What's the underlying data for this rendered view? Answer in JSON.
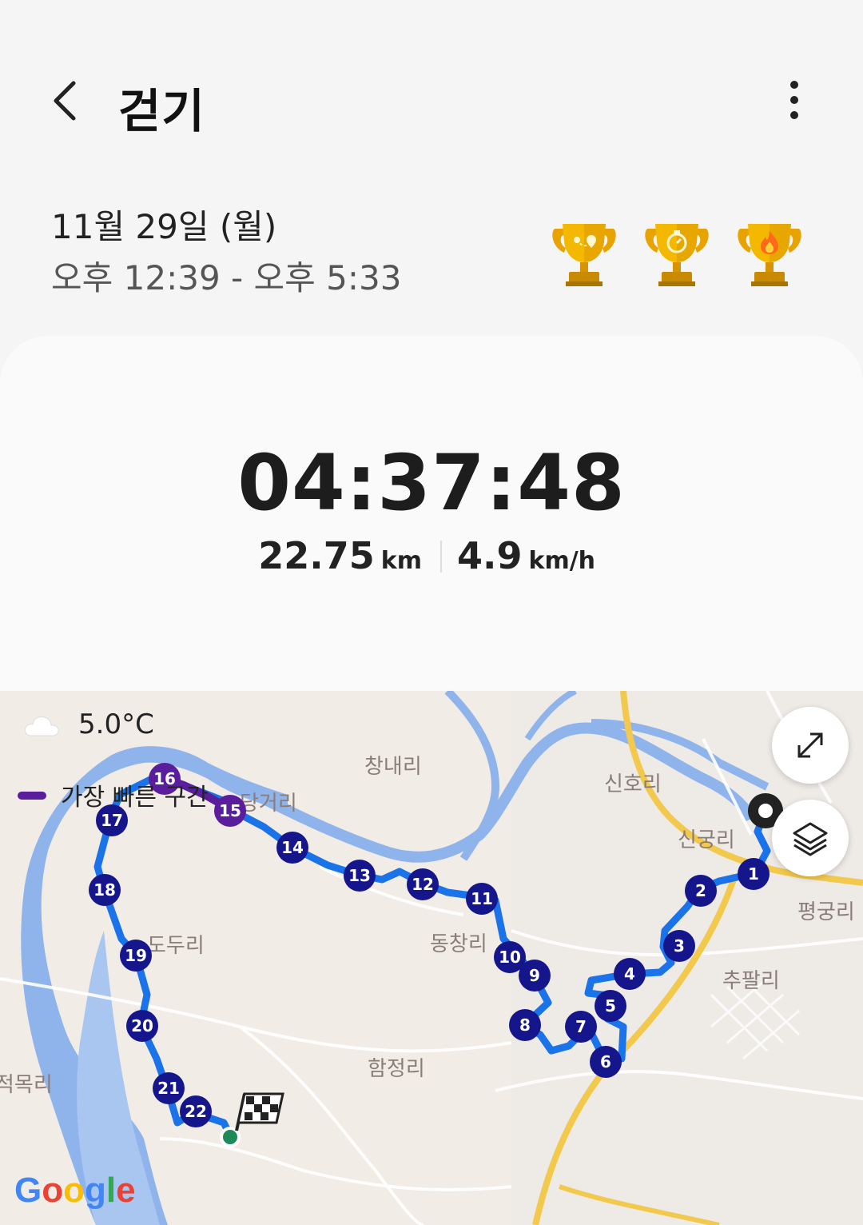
{
  "header": {
    "title": "걷기",
    "back_icon": "chevron-left-icon",
    "more_icon": "more-vertical-icon"
  },
  "session": {
    "date": "11월 29일 (월)",
    "time_range": "오후 12:39 - 오후 5:33"
  },
  "trophies": [
    {
      "icon": "trophy-distance-icon"
    },
    {
      "icon": "trophy-duration-icon"
    },
    {
      "icon": "trophy-calories-icon"
    }
  ],
  "summary": {
    "duration": "04:37:48",
    "distance": "22.75",
    "distance_unit": "km",
    "speed": "4.9",
    "speed_unit": "km/h"
  },
  "map": {
    "temperature": "5.0°C",
    "weather_icon": "cloud-icon",
    "legend_fastest": "가장 빠른 구간",
    "fastest_color": "#5a1e9c",
    "route_color": "#1a73e8",
    "marker_color": "#15158c",
    "places": {
      "changnae": "창내리",
      "sinho": "신호리",
      "danggeo": "당거리",
      "singung": "신궁리",
      "pyeonggung": "평궁리",
      "dongchang": "동창리",
      "chupal": "추팔리",
      "dodu": "도두리",
      "hamjeong": "함정리",
      "jeokmok": "적목리"
    },
    "markers": [
      "1",
      "2",
      "3",
      "4",
      "5",
      "6",
      "7",
      "8",
      "9",
      "10",
      "11",
      "12",
      "13",
      "14",
      "15",
      "16",
      "17",
      "18",
      "19",
      "20",
      "21",
      "22"
    ],
    "expand_icon": "expand-icon",
    "layers_icon": "layers-icon",
    "attribution": "Google"
  }
}
